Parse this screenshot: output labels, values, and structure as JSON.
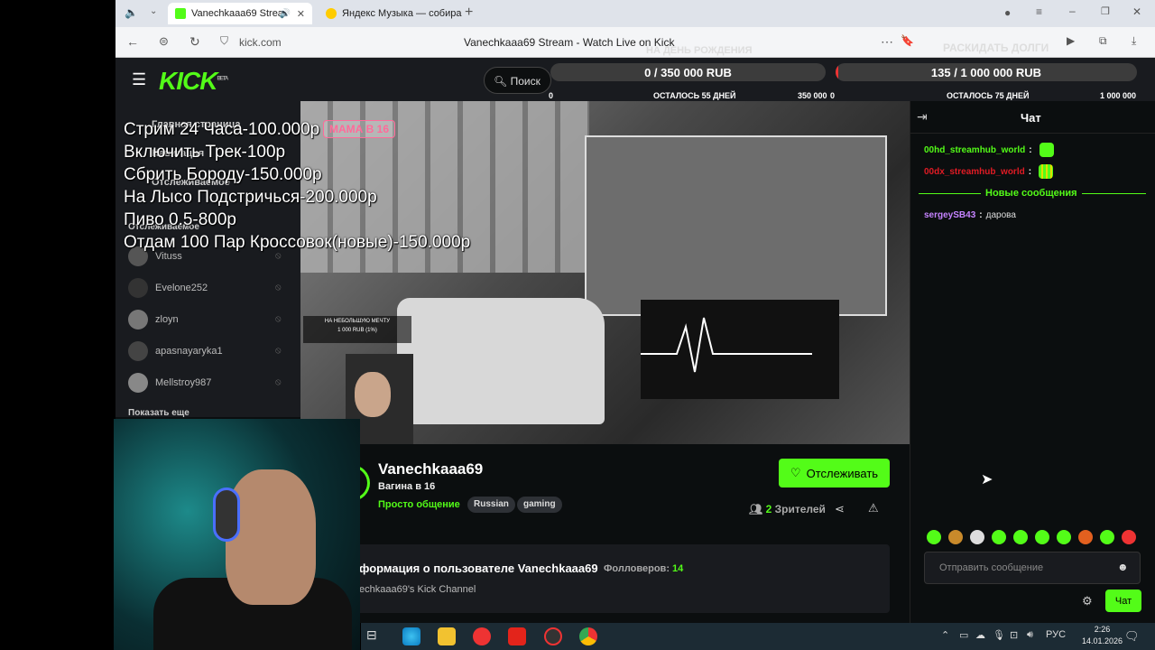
{
  "browser": {
    "tabs": [
      {
        "label": "Vanechkaaa69 Strea",
        "active": true
      },
      {
        "label": "Яндекс Музыка — собира",
        "active": false
      }
    ],
    "url": "kick.com",
    "page_title": "Vanechkaaa69 Stream - Watch Live on Kick"
  },
  "site": {
    "logo": "KICK",
    "logo_beta": "BETA",
    "search_placeholder": "Поиск"
  },
  "sidebar": {
    "home": "Главная страница",
    "browse": "Навигация",
    "following_header": "Отслеживаемое",
    "following_label": "Отслеживаемое",
    "channels": [
      {
        "name": "Vituss"
      },
      {
        "name": "Evelone252"
      },
      {
        "name": "zloyn"
      },
      {
        "name": "apasnayaryka1"
      },
      {
        "name": "Mellstroy987"
      }
    ],
    "show_more": "Показать еще"
  },
  "overlay": {
    "lines": [
      "Стрим 24 Часа-100.000р",
      "Включить Трек-100р",
      "Сбрить Бороду-150.000р",
      "На Лысо Подстричься-200.000р",
      "Пиво 0.5-800р",
      "Отдам 100 Пар Кроссовок(новые)-150.000р"
    ],
    "video_label": "МАМА В 16",
    "small_goal_title": "НА НЕБОЛЬШУЮ МЕЧТУ",
    "small_goal_value": "1 000 RUB (1%)"
  },
  "goals": [
    {
      "title": "НА ДЕНЬ РОЖДЕНИЯ",
      "value": "0 / 350 000 RUB",
      "min": "0",
      "remaining": "ОСТАЛОСЬ 55 ДНЕЙ",
      "max": "350 000",
      "progress": 0
    },
    {
      "title": "РАСКИДАТЬ ДОЛГИ",
      "value": "135 / 1 000 000 RUB",
      "min": "0",
      "remaining": "ОСТАЛОСЬ 75 ДНЕЙ",
      "max": "1 000 000",
      "progress": 0.000135
    }
  ],
  "channel": {
    "name": "Vanechkaaa69",
    "stream_title": "Вагина в 16",
    "category": "Просто общение",
    "tags": [
      "Russian",
      "gaming"
    ],
    "follow_label": "Отслеживать",
    "viewers_count": "2",
    "viewers_label": "Зрителей",
    "about_title": "формация о пользователе Vanechkaaa69",
    "followers_label": "Фолловеров:",
    "followers_count": "14",
    "description": "echkaaa69's Kick Channel"
  },
  "chat": {
    "title": "Чат",
    "messages": [
      {
        "user": "00hd_streamhub_world",
        "text": "",
        "color": "#53fc18"
      },
      {
        "user": "00dx_streamhub_world",
        "text": "",
        "color": "#e01b24"
      },
      {
        "user": "sergeySB43",
        "text": "дарова",
        "color": "#c583ff"
      }
    ],
    "new_messages": "Новые сообщения",
    "input_placeholder": "Отправить сообщение",
    "send_label": "Чат"
  },
  "taskbar": {
    "lang": "РУС",
    "time": "2:26",
    "date": "14.01.2026"
  },
  "colors": {
    "accent": "#53fc18"
  }
}
